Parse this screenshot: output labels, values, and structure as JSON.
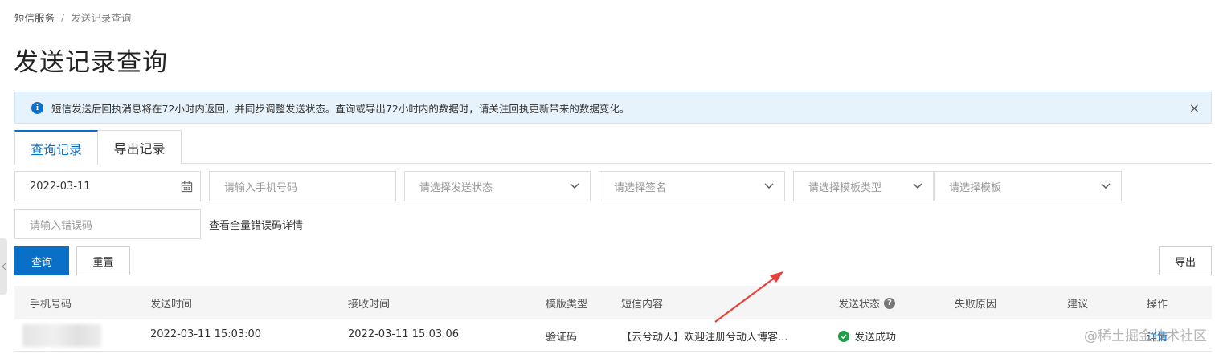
{
  "breadcrumb": {
    "root": "短信服务",
    "separator": "/",
    "current": "发送记录查询"
  },
  "page_title": "发送记录查询",
  "notice": {
    "text": "短信发送后回执消息将在72小时内返回，并同步调整发送状态。查询或导出72小时内的数据时，请关注回执更新带来的数据变化。",
    "close": "×",
    "info": "i"
  },
  "tabs": [
    {
      "label": "查询记录"
    },
    {
      "label": "导出记录"
    }
  ],
  "filters": {
    "date_value": "2022-03-11",
    "phone_placeholder": "请输入手机号码",
    "status_placeholder": "请选择发送状态",
    "sign_placeholder": "请选择签名",
    "template_type_placeholder": "请选择模板类型",
    "template_placeholder": "请选择模板",
    "error_code_placeholder": "请输入错误码",
    "error_code_link": "查看全量错误码详情"
  },
  "buttons": {
    "query": "查询",
    "reset": "重置",
    "export": "导出"
  },
  "table": {
    "columns": [
      "手机号码",
      "发送时间",
      "接收时间",
      "模版类型",
      "短信内容",
      "发送状态",
      "失败原因",
      "建议",
      "操作"
    ],
    "rows": [
      {
        "phone": "",
        "send_time": "2022-03-11 15:03:00",
        "receive_time": "2022-03-11 15:03:06",
        "template_type": "验证码",
        "content": "【云兮动人】欢迎注册兮动人博客...",
        "status": "发送成功",
        "failure_reason": "",
        "suggestion": "",
        "action": "详情"
      }
    ]
  },
  "watermark": "@稀土掘金技术社区",
  "colors": {
    "primary": "#0a6fc7",
    "notice_bg": "#e7f3fc",
    "success": "#1e9f4a",
    "arrow": "#e8403a"
  }
}
